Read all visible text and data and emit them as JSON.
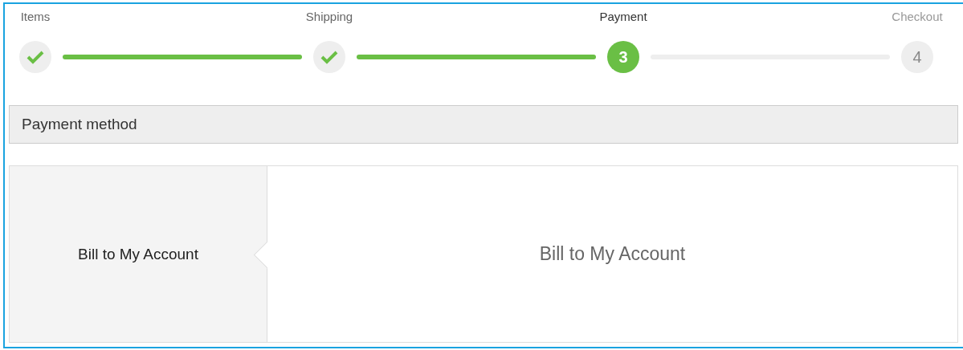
{
  "steps": [
    {
      "label": "Items",
      "done": true,
      "current": false
    },
    {
      "label": "Shipping",
      "done": true,
      "current": false
    },
    {
      "label": "Payment",
      "done": false,
      "current": true,
      "number": "3"
    },
    {
      "label": "Checkout",
      "done": false,
      "current": false,
      "number": "4"
    }
  ],
  "section": {
    "title": "Payment method"
  },
  "methods": [
    {
      "label": "Bill to My Account",
      "selected": true
    }
  ],
  "detail": {
    "title": "Bill to My Account"
  }
}
